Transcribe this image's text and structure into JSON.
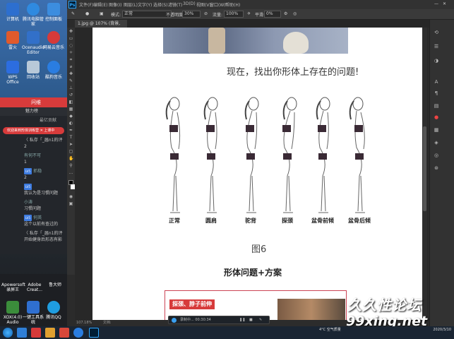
{
  "desktop": {
    "icons": [
      {
        "label": "计算机",
        "color": "#2d6fcf"
      },
      {
        "label": "腾讯电脑管家",
        "color": "#2f8ae0"
      },
      {
        "label": "控制面板",
        "color": "#3c8ddf"
      },
      {
        "label": "雷火",
        "color": "#e05a2c"
      },
      {
        "label": "Ocenaudio Editor",
        "color": "#3270c9"
      },
      {
        "label": "网易云音乐",
        "color": "#d63a3a"
      },
      {
        "label": "WPS Office",
        "color": "#2c6de0"
      },
      {
        "label": "回收站",
        "color": "#b8c8d8"
      },
      {
        "label": "酷狗音乐",
        "color": "#2a7de1"
      }
    ],
    "lower_icons": [
      {
        "label": "Apowersoft 录屏王",
        "color": "#2c8ee0"
      },
      {
        "label": "Adobe Creat...",
        "color": "#d03030"
      },
      {
        "label": "鲁大师",
        "color": "#e0b020"
      },
      {
        "label": "XOX(4.0) Audio",
        "color": "#3b8d3b"
      },
      {
        "label": "一键工具系统",
        "color": "#2f6fd0"
      },
      {
        "label": "腾讯QQ",
        "color": "#1f9de0"
      }
    ]
  },
  "chat": {
    "title": "问维",
    "tabs": "魅力榜",
    "header": "最亿贡献",
    "banner": "欢迎来到形体训练营 ✕ 上课中",
    "messages": [
      {
        "who": "",
        "text": "〈 私存「_届n1的评",
        "sub": "2"
      },
      {
        "who": "有何不可",
        "text": "1",
        "sub": ""
      },
      {
        "who": "抓稳",
        "text": "2",
        "sub": "",
        "tag": "LV5"
      },
      {
        "who": "",
        "text": "我认为是习惯问题",
        "sub": "",
        "tag": "LV5"
      },
      {
        "who": "小涛",
        "text": "习惯问题",
        "sub": ""
      },
      {
        "who": "何英",
        "text": "这个以前有查过的",
        "sub": "",
        "tag": "LV5"
      },
      {
        "who": "",
        "text": "〈 私存「_届n1的评",
        "sub": "开始健身后形态有影"
      }
    ]
  },
  "photoshop": {
    "menu": [
      "文件(F)",
      "编辑(E)",
      "图像(I)",
      "图层(L)",
      "文字(Y)",
      "选择(S)",
      "滤镜(T)",
      "3D(D)",
      "视图(V)",
      "窗口(W)",
      "帮助(H)"
    ],
    "options": {
      "mode_label": "模式:",
      "mode_value": "正常",
      "opacity_label": "不透明度:",
      "opacity_value": "30%",
      "flow_label": "流量:",
      "flow_value": "100%",
      "smooth_label": "平滑:",
      "smooth_value": "0%"
    },
    "doc_tab": "1.jpg @ 107% (背景, RGB/8) *",
    "status_zoom": "107.18%",
    "status_doc": "文档:"
  },
  "document": {
    "heading": "现在，找出你形体上存在的问题!",
    "figures": [
      "正常",
      "圆肩",
      "驼背",
      "探颈",
      "盆骨前倾",
      "盆骨后倾"
    ],
    "caption": "图6",
    "section_title": "形体问题+方案",
    "card_tag": "探颈、脖子前伸"
  },
  "recorder": {
    "text": "录制中... 00:30:34"
  },
  "watermark": {
    "line1": "久久性论坛",
    "line2": "99xing.net"
  },
  "taskbar": {
    "weather": "4°C\n空气质量",
    "time": "2020/3/10"
  }
}
